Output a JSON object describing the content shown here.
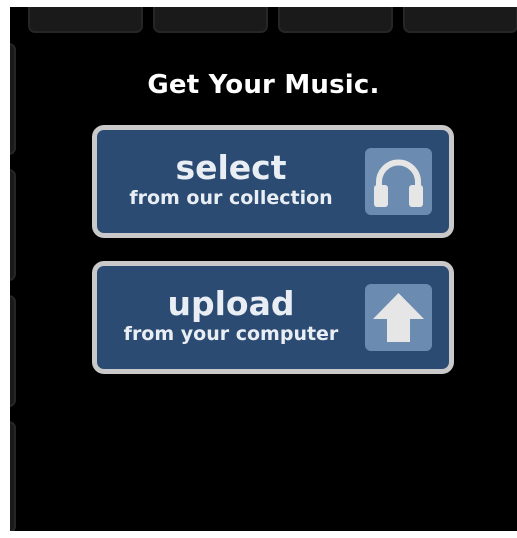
{
  "heading": "Get Your Music.",
  "buttons": {
    "select": {
      "label": "select",
      "sublabel": "from our collection",
      "icon": "headphones-icon"
    },
    "upload": {
      "label": "upload",
      "sublabel": "from your computer",
      "icon": "upload-arrow-icon"
    }
  },
  "colors": {
    "background": "#000000",
    "button_fill": "#2c4b73",
    "button_border": "#c9c9c9",
    "icon_box": "#6c8bb0",
    "icon_glyph": "#e6e6e6",
    "text": "#ffffff"
  }
}
